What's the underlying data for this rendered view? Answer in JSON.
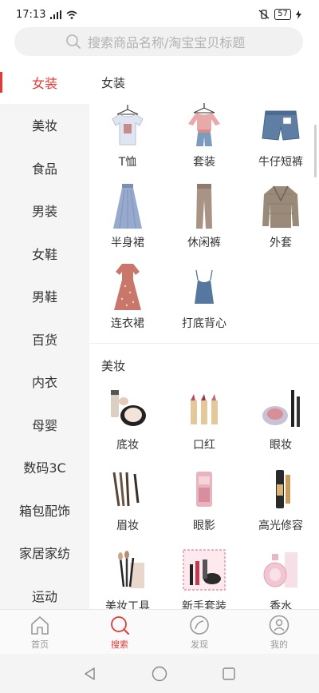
{
  "status_bar": {
    "time": "17:13",
    "battery": "57"
  },
  "search": {
    "placeholder": "搜索商品名称/淘宝宝贝标题"
  },
  "sidebar": {
    "items": [
      {
        "label": "女装",
        "active": true
      },
      {
        "label": "美妆"
      },
      {
        "label": "食品"
      },
      {
        "label": "男装"
      },
      {
        "label": "女鞋"
      },
      {
        "label": "男鞋"
      },
      {
        "label": "百货"
      },
      {
        "label": "内衣"
      },
      {
        "label": "母婴"
      },
      {
        "label": "数码3C"
      },
      {
        "label": "箱包配饰"
      },
      {
        "label": "家居家纺"
      },
      {
        "label": "运动"
      }
    ]
  },
  "sections": [
    {
      "title": "女装",
      "items": [
        {
          "label": "T恤",
          "icon": "tshirt-icon"
        },
        {
          "label": "套装",
          "icon": "outfit-set-icon"
        },
        {
          "label": "牛仔短裤",
          "icon": "denim-shorts-icon"
        },
        {
          "label": "半身裙",
          "icon": "skirt-icon"
        },
        {
          "label": "休闲裤",
          "icon": "casual-pants-icon"
        },
        {
          "label": "外套",
          "icon": "coat-icon"
        },
        {
          "label": "连衣裙",
          "icon": "dress-icon"
        },
        {
          "label": "打底背心",
          "icon": "camisole-icon"
        }
      ]
    },
    {
      "title": "美妆",
      "items": [
        {
          "label": "底妆",
          "icon": "foundation-icon"
        },
        {
          "label": "口红",
          "icon": "lipstick-icon"
        },
        {
          "label": "眼妆",
          "icon": "eye-makeup-icon"
        },
        {
          "label": "眉妆",
          "icon": "eyebrow-pencil-icon"
        },
        {
          "label": "眼影",
          "icon": "eyeshadow-icon"
        },
        {
          "label": "高光修容",
          "icon": "highlighter-icon"
        },
        {
          "label": "美妆工具",
          "icon": "makeup-brush-icon"
        },
        {
          "label": "新手套装",
          "icon": "starter-kit-icon"
        },
        {
          "label": "香水",
          "icon": "perfume-icon"
        }
      ]
    }
  ],
  "tabbar": {
    "tabs": [
      {
        "label": "首页",
        "icon": "home-icon"
      },
      {
        "label": "搜索",
        "icon": "search-icon",
        "active": true
      },
      {
        "label": "发现",
        "icon": "discover-icon"
      },
      {
        "label": "我的",
        "icon": "profile-icon"
      }
    ]
  },
  "colors": {
    "accent": "#e53935",
    "sidebar_bg": "#f5f5f5"
  }
}
